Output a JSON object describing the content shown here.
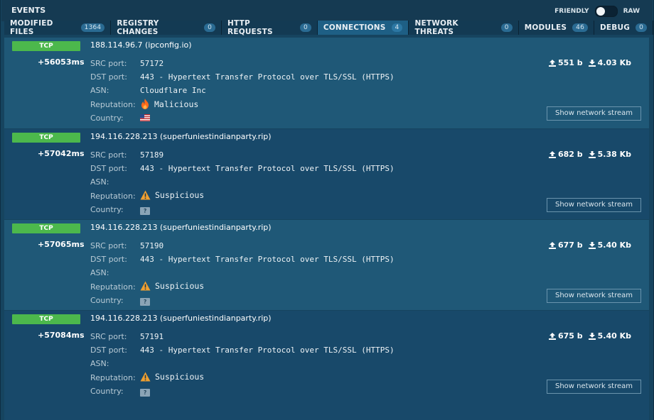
{
  "header": {
    "title": "EVENTS",
    "mode_left": "FRIENDLY",
    "mode_right": "RAW"
  },
  "tabs": [
    {
      "label": "MODIFIED FILES",
      "count": "1364",
      "active": false
    },
    {
      "label": "REGISTRY CHANGES",
      "count": "0",
      "active": false
    },
    {
      "label": "HTTP REQUESTS",
      "count": "0",
      "active": false
    },
    {
      "label": "CONNECTIONS",
      "count": "4",
      "active": true
    },
    {
      "label": "NETWORK THREATS",
      "count": "0",
      "active": false
    },
    {
      "label": "MODULES",
      "count": "46",
      "active": false
    },
    {
      "label": "DEBUG",
      "count": "0",
      "active": false
    }
  ],
  "labels": {
    "src": "SRC port:",
    "dst": "DST port:",
    "asn": "ASN:",
    "reputation": "Reputation:",
    "country": "Country:",
    "stream_button": "Show network stream",
    "unknown_country": "?"
  },
  "events": [
    {
      "protocol": "TCP",
      "time": "+56053ms",
      "host": "188.114.96.7 (ipconfig.io)",
      "src_port": "57172",
      "dst_port": "443 - Hypertext Transfer Protocol over TLS/SSL (HTTPS)",
      "asn": "Cloudflare Inc",
      "reputation": "Malicious",
      "rep_icon": "fire-icon",
      "country_icon": "us-flag-icon",
      "upload": "551 b",
      "download": "4.03 Kb"
    },
    {
      "protocol": "TCP",
      "time": "+57042ms",
      "host": "194.116.228.213 (superfuniestindianparty.rip)",
      "src_port": "57189",
      "dst_port": "443 - Hypertext Transfer Protocol over TLS/SSL (HTTPS)",
      "asn": "",
      "reputation": "Suspicious",
      "rep_icon": "warning-icon",
      "country_icon": "unknown-flag-icon",
      "upload": "682 b",
      "download": "5.38 Kb"
    },
    {
      "protocol": "TCP",
      "time": "+57065ms",
      "host": "194.116.228.213 (superfuniestindianparty.rip)",
      "src_port": "57190",
      "dst_port": "443 - Hypertext Transfer Protocol over TLS/SSL (HTTPS)",
      "asn": "",
      "reputation": "Suspicious",
      "rep_icon": "warning-icon",
      "country_icon": "unknown-flag-icon",
      "upload": "677 b",
      "download": "5.40 Kb"
    },
    {
      "protocol": "TCP",
      "time": "+57084ms",
      "host": "194.116.228.213 (superfuniestindianparty.rip)",
      "src_port": "57191",
      "dst_port": "443 - Hypertext Transfer Protocol over TLS/SSL (HTTPS)",
      "asn": "",
      "reputation": "Suspicious",
      "rep_icon": "warning-icon",
      "country_icon": "unknown-flag-icon",
      "upload": "675 b",
      "download": "5.40 Kb"
    }
  ],
  "colors": {
    "tcp_badge": "#4cb84c",
    "active_tab": "#1e5f85",
    "warning": "#f0a030",
    "fire": "#ff6a1a"
  }
}
